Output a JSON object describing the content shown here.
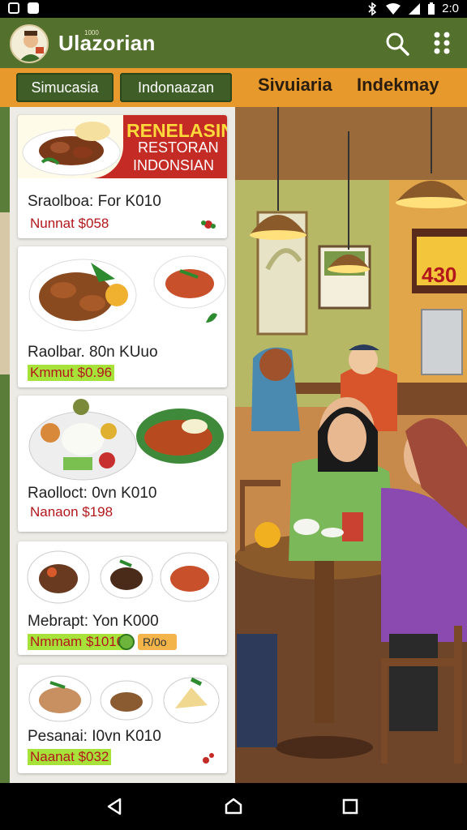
{
  "status_bar": {
    "time": "2:0"
  },
  "app_bar": {
    "title": "Ulazorian",
    "subtitle": "1000",
    "search_icon": "search-icon",
    "menu_icon": "grid-menu-icon"
  },
  "chips": {
    "chip1": "Simucasia",
    "chip2": "Indonaazan",
    "text1": "Sivuiaria",
    "text2": "Indekmay"
  },
  "promo": {
    "line1": "RENELASIN",
    "line2": "RESTORAN",
    "line3": "INDONSIAN"
  },
  "cards": [
    {
      "name": "Sraolboa: For K010",
      "price": "Nunnat $058"
    },
    {
      "name": "Raolbar. 80n KUuo",
      "price": "Kmmut $0.96"
    },
    {
      "name": "Raolloct: 0vn K010",
      "price": "Nanaon $198"
    },
    {
      "name": "Mebrapt: Yon K000",
      "price": "Nmmam $1010",
      "tag": "R/0o"
    },
    {
      "name": "Pesanai: I0vn K010",
      "price": "Naanat $032"
    }
  ],
  "scene": {
    "sign_value": "430"
  },
  "colors": {
    "appbar": "#54702d",
    "chipsbar": "#e79a2b",
    "chip": "#3f5e27",
    "price_red": "#b3171b",
    "price_highlight": "#a7e23a"
  }
}
